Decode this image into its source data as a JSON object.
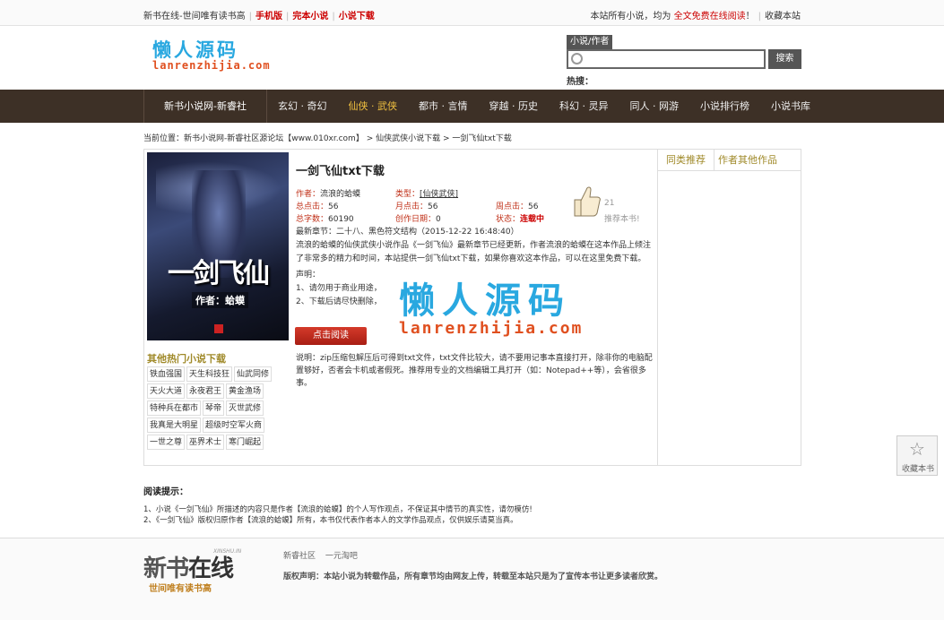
{
  "topbar": {
    "site_slogan": "新书在线-世间唯有读书高",
    "mobile": "手机版",
    "complete": "完本小说",
    "download": "小说下载",
    "notice_prefix": "本站所有小说，均为",
    "notice_red": "全文免费在线阅读",
    "notice_suffix": "！",
    "favorite": "收藏本站"
  },
  "logo": {
    "cn": "懒人源码",
    "en": "lanrenzhijia.com"
  },
  "search": {
    "tab": "小说/作者",
    "button": "搜索",
    "hot_label": "热搜："
  },
  "nav": {
    "home": "新书小说网-新睿社",
    "items": [
      "玄幻 · 奇幻",
      "仙侠 · 武侠",
      "都市 · 言情",
      "穿越 · 历史",
      "科幻 · 灵异",
      "同人 · 网游",
      "小说排行榜",
      "小说书库"
    ],
    "active_index": 1
  },
  "breadcrumb": "当前位置：新书小说网-新睿社区源论坛【www.010xr.com】 > 仙侠武侠小说下载 > 一剑飞仙txt下载",
  "book": {
    "title": "一剑飞仙txt下载",
    "cover_title": "一剑飞仙",
    "cover_author": "作者：蛤蟆",
    "author_key": "作者：",
    "author_val": "流浪的蛤蟆",
    "type_key": "类型：",
    "type_val": "[仙侠武侠]",
    "total_click_key": "总点击：",
    "total_click_val": "56",
    "month_click_key": "月点击：",
    "month_click_val": "56",
    "week_click_key": "周点击：",
    "week_click_val": "56",
    "words_key": "总字数：",
    "words_val": "60190",
    "date_key": "创作日期：",
    "date_val": "0",
    "status_key": "状态：",
    "status_val": "连载中",
    "thumb_count": "21",
    "thumb_label": "推荐本书!",
    "latest": "最新章节：二十八、黑色符文结构（2015-12-22 16:48:40）",
    "desc": "流浪的蛤蟆的仙侠武侠小说作品《一剑飞仙》最新章节已经更新，作者流浪的蛤蟆在这本作品上倾注了非常多的精力和时间，本站提供一剑飞仙txt下载，如果你喜欢这本作品，可以在这里免费下载。",
    "statement_title": "声明：",
    "statement_1": "1、请勿用于商业用途，",
    "statement_2": "2、下载后请尽快删除，",
    "read_button": "点击阅读",
    "note": "说明：zip压缩包解压后可得到txt文件，txt文件比较大，请不要用记事本直接打开，除非你的电脑配置够好，否者会卡机或者假死。推荐用专业的文档编辑工具打开（如：Notepad++等），会省很多事。"
  },
  "watermark": {
    "cn": "懒人源码",
    "en": "lanrenzhijia.com"
  },
  "sidebar": {
    "tab1": "同类推荐",
    "tab2": "作者其他作品"
  },
  "hot": {
    "title": "其他热门小说下载",
    "items": [
      "铁血强国",
      "天生科技狂",
      "仙武同修",
      "天火大道",
      "永夜君王",
      "黄金渔场",
      "特种兵在都市",
      "琴帝",
      "灭世武修",
      "我真是大明星",
      "超级时空军火商",
      "一世之尊",
      "巫界术士",
      "寒门崛起"
    ]
  },
  "tips": {
    "title": "阅读提示：",
    "line1": "1、小说《一剑飞仙》所描述的内容只是作者【流浪的蛤蟆】的个人写作观点，不保证其中情节的真实性，请勿模仿!",
    "line2": "2、《一剑飞仙》版权归原作者【流浪的蛤蟆】所有，本书仅代表作者本人的文学作品观点，仅供娱乐请莫当真。"
  },
  "footer": {
    "logo_main_1": "新书",
    "logo_main_2": "在线",
    "logo_sub": "世间唯有读书高",
    "logo_tiny": "XINSHU.IN",
    "link1": "新睿社区",
    "link2": "一元淘吧",
    "copyright": "版权声明：本站小说为转载作品，所有章节均由网友上传，转载至本站只是为了宣传本书让更多读者欣赏。"
  },
  "fav_float": {
    "label": "收藏本书"
  }
}
